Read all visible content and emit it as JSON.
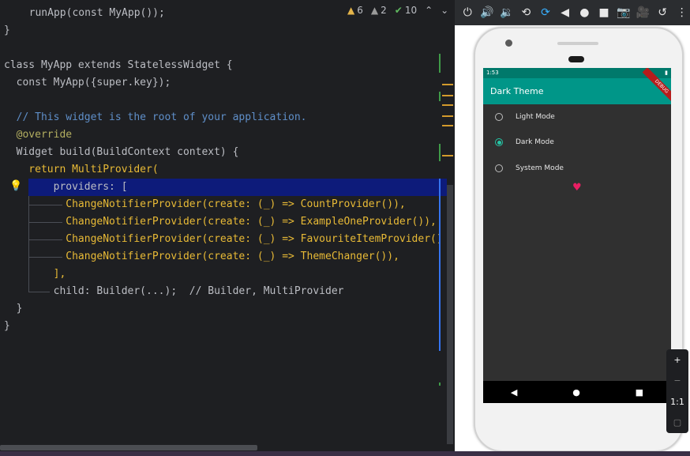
{
  "inspections": {
    "warnings": "6",
    "weak_warnings": "2",
    "typos": "10"
  },
  "code_lines": [
    "  runApp(const MyApp());",
    "}",
    "",
    "class MyApp extends StatelessWidget {",
    "  const MyApp({super.key});",
    "",
    "  // This widget is the root of your application.",
    "  @override",
    "  Widget build(BuildContext context) {",
    "    return MultiProvider(",
    "        providers: [",
    "          ChangeNotifierProvider(create: (_) => CountProvider()),",
    "          ChangeNotifierProvider(create: (_) => ExampleOneProvider()),",
    "          ChangeNotifierProvider(create: (_) => FavouriteItemProvider()",
    "          ChangeNotifierProvider(create: (_) => ThemeChanger()),",
    "        ],",
    "        child: Builder(...);  // Builder, MultiProvider",
    "  }",
    "}"
  ],
  "phone": {
    "status_time": "1:53",
    "app_title": "Dark Theme",
    "debug_banner": "DEBUG",
    "options": [
      {
        "label": "Light Mode",
        "selected": false
      },
      {
        "label": "Dark Mode",
        "selected": true
      },
      {
        "label": "System Mode",
        "selected": false
      }
    ]
  },
  "zoom": {
    "plus": "+",
    "minus": "−",
    "ratio": "1:1"
  },
  "colors": {
    "editor_bg": "#1e1f22",
    "appbar": "#009688",
    "accent": "#26c6a6",
    "heart": "#e91e63",
    "selection": "#0d1b7a"
  },
  "icons": [
    "power-icon",
    "volume-up-icon",
    "volume-down-icon",
    "rotate-left-icon",
    "rotate-right-icon",
    "back-icon",
    "home-icon",
    "overview-icon",
    "camera-icon",
    "record-icon",
    "replay-icon",
    "more-icon"
  ]
}
